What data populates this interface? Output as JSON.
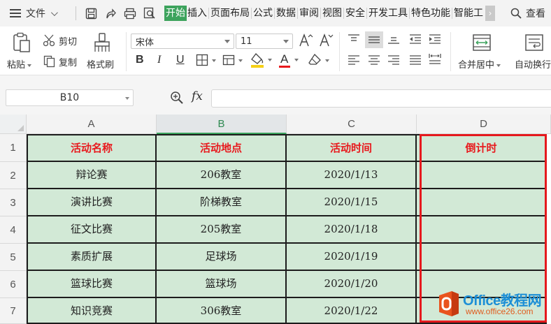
{
  "menubar": {
    "file_label": "文件",
    "tabs": [
      "开始",
      "插入",
      "页面布局",
      "公式",
      "数据",
      "审阅",
      "视图",
      "安全",
      "开发工具",
      "特色功能",
      "智能工"
    ],
    "active_tab": "开始",
    "more_label": "›",
    "search_label": "查看"
  },
  "ribbon": {
    "paste_label": "粘贴",
    "cut_label": "剪切",
    "copy_label": "复制",
    "format_painter_label": "格式刷",
    "font_name": "宋体",
    "font_size": "11",
    "bold": "B",
    "italic": "I",
    "underline": "U",
    "font_color_glyph": "A",
    "merge_label": "合并居中",
    "wrap_label": "自动换行",
    "accent_green": "#3da35d",
    "font_color_bar": "#e8191d",
    "fill_color_bar": "#f5d017"
  },
  "formula_bar": {
    "name_box": "B10",
    "fx_label": "fx",
    "value": ""
  },
  "sheet": {
    "columns": [
      "A",
      "B",
      "C",
      "D"
    ],
    "selected_column": "B",
    "row_numbers": [
      "1",
      "2",
      "3",
      "4",
      "5",
      "6",
      "7"
    ],
    "header_row": [
      "活动名称",
      "活动地点",
      "活动时间",
      "倒计时"
    ],
    "rows": [
      [
        "辩论赛",
        "206教室",
        "2020/1/13",
        ""
      ],
      [
        "演讲比赛",
        "阶梯教室",
        "2020/1/15",
        ""
      ],
      [
        "征文比赛",
        "205教室",
        "2020/1/18",
        ""
      ],
      [
        "素质扩展",
        "足球场",
        "2020/1/19",
        ""
      ],
      [
        "篮球比赛",
        "篮球场",
        "2020/1/20",
        ""
      ],
      [
        "知识竞赛",
        "306教室",
        "2020/1/22",
        ""
      ]
    ],
    "cell_fill": "#d2e9d6",
    "header_text_color": "#e8191d",
    "highlight_border": "#e5191d"
  },
  "watermark": {
    "title": "Office教程网",
    "url": "www.office26.com"
  }
}
